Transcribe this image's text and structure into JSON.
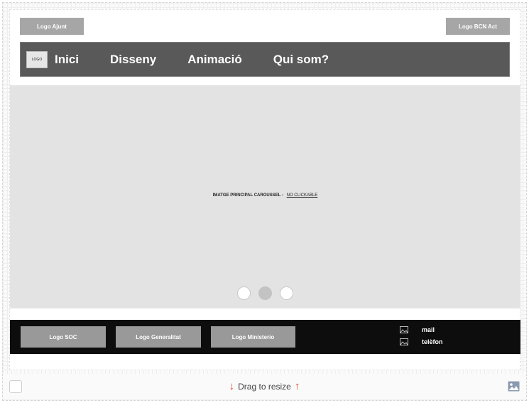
{
  "header": {
    "logo_left": "Logo Ajunt",
    "logo_right": "Logo BCN Act"
  },
  "nav": {
    "logo": "LOGO",
    "items": [
      "Inici",
      "Disseny",
      "Animació",
      "Qui som?"
    ]
  },
  "hero": {
    "caption": "IMATGE PRINCIPAL CAROUSSEL -",
    "caption_note": "NO CLICKABLE",
    "dots": 3,
    "active_dot": 2
  },
  "footer": {
    "logos": [
      "Logo SOC",
      "Logo Generalitat",
      "Logo Ministerio"
    ],
    "contact": {
      "mail": "mail",
      "phone": "telèfon"
    }
  },
  "bottom_bar": {
    "drag_label": "Drag to resize"
  },
  "colors": {
    "nav_bg": "#595959",
    "footer_bg": "#0d0d0d",
    "hero_bg": "#e3e3e3",
    "drag_arrows": "#e0472c"
  }
}
